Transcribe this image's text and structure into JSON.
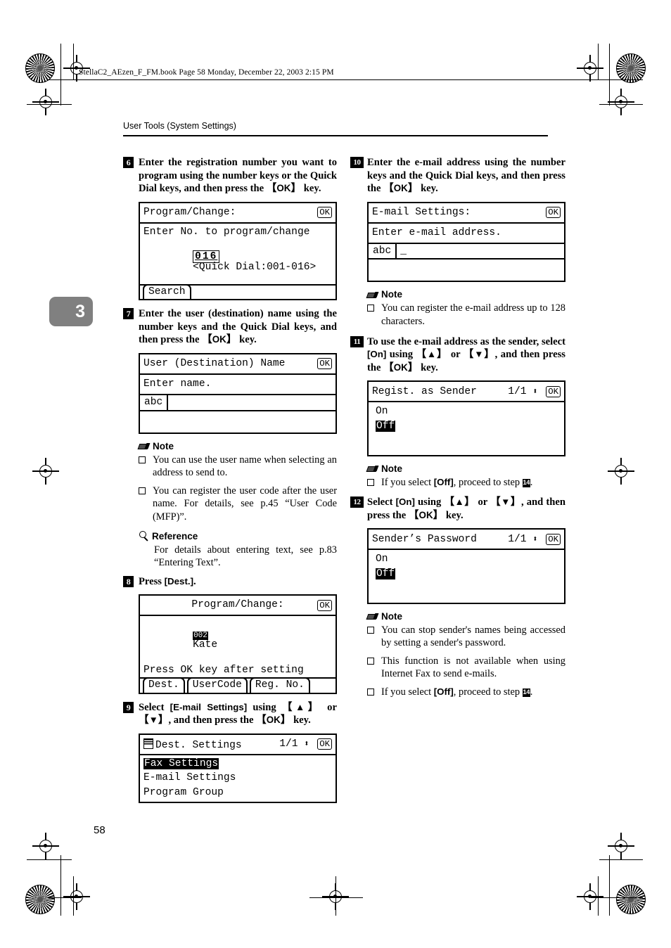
{
  "fileinfo": "StellaC2_AEzen_F_FM.book  Page 58  Monday, December 22, 2003  2:15 PM",
  "header": {
    "title": "User Tools (System Settings)"
  },
  "chapter_tab": "3",
  "page_number": "58",
  "left_column": {
    "step6": {
      "number": "6",
      "text_a": "Enter the registration number you want to program using the number keys or the Quick Dial keys, and then press the ",
      "key": "OK",
      "text_b": " key.",
      "lcd": {
        "title": "Program/Change:",
        "ok": "OK",
        "line1": "Enter No. to program/change",
        "value": "016",
        "range": "<Quick Dial:001-016>",
        "tab1": "Search"
      }
    },
    "step7": {
      "number": "7",
      "text_a": "Enter the user (destination) name using the number keys and the Quick Dial keys, and then press the ",
      "key": "OK",
      "text_b": " key.",
      "lcd": {
        "title": "User (Destination) Name",
        "ok": "OK",
        "line1": "Enter name.",
        "mode": "abc",
        "field": ""
      }
    },
    "note1": {
      "label": "Note",
      "items": [
        "You can use the user name when selecting an address to send to.",
        "You can register the user code after the user name. For details, see p.45 “User Code (MFP)”."
      ]
    },
    "reference1": {
      "label": "Reference",
      "body": "For details about entering text, see p.83 “Entering Text”."
    },
    "step8": {
      "number": "8",
      "text_a": "Press ",
      "bracket": "[Dest.]",
      "text_b": ".",
      "lcd": {
        "title": "Program/Change:",
        "ok": "OK",
        "badge": "002",
        "name": "Kate",
        "line2": "Press OK key after setting",
        "tab1": "Dest.",
        "tab2": "UserCode",
        "tab3": "Reg. No."
      }
    },
    "step9": {
      "number": "9",
      "text_a": "Select ",
      "bracket": "[E-mail Settings]",
      "text_b": " using ",
      "key_up": "▲",
      "text_c": " or ",
      "key_down": "▼",
      "text_d": ", and then press the ",
      "key_ok": "OK",
      "text_e": " key.",
      "lcd": {
        "title": "Dest. Settings",
        "page": "1/1",
        "ok": "OK",
        "item1": "Fax Settings",
        "item2": "E-mail Settings",
        "item3": "Program Group",
        "selected": "Fax Settings"
      }
    }
  },
  "right_column": {
    "step10": {
      "number": "10",
      "text_a": "Enter the e-mail address using the number keys and the Quick Dial keys, and then press the ",
      "key": "OK",
      "text_b": " key.",
      "lcd": {
        "title": "E-mail Settings:",
        "ok": "OK",
        "line1": "Enter e-mail address.",
        "mode": "abc",
        "field": "_"
      }
    },
    "note2": {
      "label": "Note",
      "items": [
        "You can register the e-mail address up to 128 characters."
      ]
    },
    "step11": {
      "number": "11",
      "text_a": "To use the e-mail address as the sender, select ",
      "bracket": "[On]",
      "text_b": " using ",
      "key_up": "▲",
      "text_c": " or ",
      "key_down": "▼",
      "text_d": ", and then press the ",
      "key_ok": "OK",
      "text_e": " key.",
      "lcd": {
        "title": "Regist. as Sender",
        "page": "1/1",
        "ok": "OK",
        "item1": "On",
        "item2": "Off",
        "selected": "Off"
      }
    },
    "note3": {
      "label": "Note",
      "item_a": "If you select ",
      "item_bracket": "[Off]",
      "item_b": ", proceed to step ",
      "item_step": "14",
      "item_c": "."
    },
    "step12": {
      "number": "12",
      "text_a": "Select ",
      "bracket": "[On]",
      "text_b": " using ",
      "key_up": "▲",
      "text_c": " or ",
      "key_down": "▼",
      "text_d": ", and then press the ",
      "key_ok": "OK",
      "text_e": " key.",
      "lcd": {
        "title": "Sender’s Password",
        "page": "1/1",
        "ok": "OK",
        "item1": "On",
        "item2": "Off",
        "selected": "Off"
      }
    },
    "note4": {
      "label": "Note",
      "item1": "You can stop sender's names being accessed by setting a sender's password.",
      "item2": "This function is not available when using Internet Fax to send e-mails.",
      "item3_a": "If you select ",
      "item3_bracket": "[Off]",
      "item3_b": ", proceed to step ",
      "item3_step": "14",
      "item3_c": "."
    }
  }
}
